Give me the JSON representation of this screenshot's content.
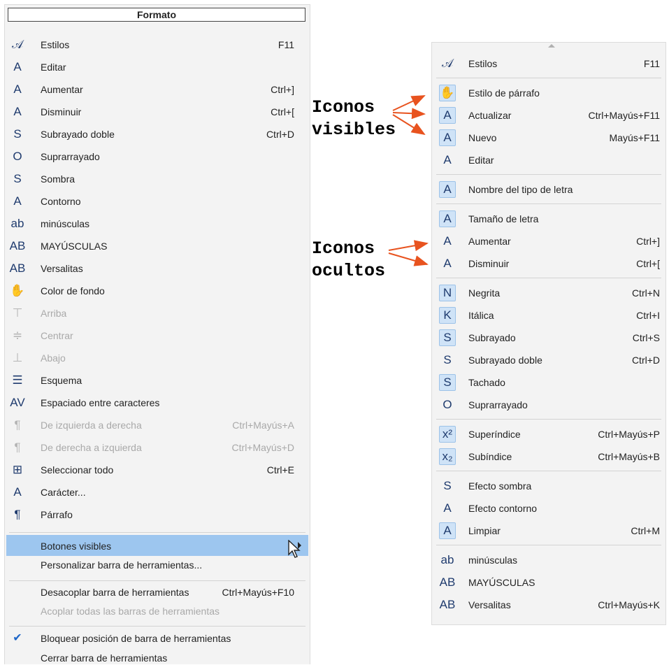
{
  "left_menu": {
    "title": "Formato",
    "items": [
      {
        "name": "estilos",
        "icon": "styles-icon",
        "glyph": "𝒜",
        "label": "Estilos",
        "shortcut": "F11"
      },
      {
        "name": "editar",
        "icon": "edit-style-icon",
        "glyph": "A",
        "label": "Editar",
        "shortcut": ""
      },
      {
        "name": "aumentar",
        "icon": "grow-font-icon",
        "glyph": "A",
        "label": "Aumentar",
        "shortcut": "Ctrl+]"
      },
      {
        "name": "disminuir",
        "icon": "shrink-font-icon",
        "glyph": "A",
        "label": "Disminuir",
        "shortcut": "Ctrl+["
      },
      {
        "name": "subrayado-doble",
        "icon": "double-underline-icon",
        "glyph": "S",
        "label": "Subrayado doble",
        "shortcut": "Ctrl+D"
      },
      {
        "name": "suprarrayado",
        "icon": "overline-icon",
        "glyph": "O",
        "label": "Suprarrayado",
        "shortcut": ""
      },
      {
        "name": "sombra",
        "icon": "shadow-icon",
        "glyph": "S",
        "label": "Sombra",
        "shortcut": ""
      },
      {
        "name": "contorno",
        "icon": "outline-icon",
        "glyph": "A",
        "label": "Contorno",
        "shortcut": ""
      },
      {
        "name": "minusculas",
        "icon": "lowercase-icon",
        "glyph": "ab",
        "label": "minúsculas",
        "shortcut": ""
      },
      {
        "name": "mayusculas",
        "icon": "uppercase-icon",
        "glyph": "AB",
        "label": "MAYÚSCULAS",
        "shortcut": ""
      },
      {
        "name": "versalitas",
        "icon": "smallcaps-icon",
        "glyph": "AB",
        "label": "Versalitas",
        "shortcut": ""
      },
      {
        "name": "color-fondo",
        "icon": "background-color-icon",
        "glyph": "✋",
        "label": "Color de fondo",
        "shortcut": ""
      },
      {
        "name": "arriba",
        "icon": "align-top-icon",
        "glyph": "⊤",
        "label": "Arriba",
        "shortcut": "",
        "disabled": true
      },
      {
        "name": "centrar",
        "icon": "align-middle-icon",
        "glyph": "≑",
        "label": "Centrar",
        "shortcut": "",
        "disabled": true
      },
      {
        "name": "abajo",
        "icon": "align-bottom-icon",
        "glyph": "⊥",
        "label": "Abajo",
        "shortcut": "",
        "disabled": true
      },
      {
        "name": "esquema",
        "icon": "outline-numbering-icon",
        "glyph": "☰",
        "label": "Esquema",
        "shortcut": ""
      },
      {
        "name": "espaciado",
        "icon": "char-spacing-icon",
        "glyph": "AV",
        "label": "Espaciado entre caracteres",
        "shortcut": ""
      },
      {
        "name": "izq-der",
        "icon": "ltr-icon",
        "glyph": "¶",
        "label": "De izquierda a derecha",
        "shortcut": "Ctrl+Mayús+A",
        "disabled": true
      },
      {
        "name": "der-izq",
        "icon": "rtl-icon",
        "glyph": "¶",
        "label": "De derecha a izquierda",
        "shortcut": "Ctrl+Mayús+D",
        "disabled": true
      },
      {
        "name": "seleccionar-todo",
        "icon": "select-all-icon",
        "glyph": "⊞",
        "label": "Seleccionar todo",
        "shortcut": "Ctrl+E"
      },
      {
        "name": "caracter",
        "icon": "character-icon",
        "glyph": "A",
        "label": "Carácter...",
        "shortcut": ""
      },
      {
        "name": "parrafo",
        "icon": "paragraph-icon",
        "glyph": "¶",
        "label": "Párrafo",
        "shortcut": ""
      }
    ],
    "botones_visibles": "Botones visibles",
    "personalizar": "Personalizar barra de herramientas...",
    "desacoplar": "Desacoplar barra de herramientas",
    "desacoplar_shortcut": "Ctrl+Mayús+F10",
    "acoplar": "Acoplar todas las barras de herramientas",
    "bloquear": "Bloquear posición de barra de herramientas",
    "cerrar": "Cerrar barra de herramientas"
  },
  "right_menu": {
    "groups": [
      [
        {
          "name": "estilos",
          "icon": "styles-icon",
          "glyph": "𝒜",
          "label": "Estilos",
          "shortcut": "F11"
        }
      ],
      [
        {
          "name": "estilo-parrafo",
          "icon": "paragraph-style-icon",
          "glyph": "✋",
          "label": "Estilo de párrafo",
          "shortcut": "",
          "boxed": true
        },
        {
          "name": "actualizar",
          "icon": "update-style-icon",
          "glyph": "A",
          "label": "Actualizar",
          "shortcut": "Ctrl+Mayús+F11",
          "boxed": true
        },
        {
          "name": "nuevo",
          "icon": "new-style-icon",
          "glyph": "A",
          "label": "Nuevo",
          "shortcut": "Mayús+F11",
          "boxed": true
        },
        {
          "name": "editar",
          "icon": "edit-style-icon",
          "glyph": "A",
          "label": "Editar",
          "shortcut": ""
        }
      ],
      [
        {
          "name": "nombre-letra",
          "icon": "font-name-icon",
          "glyph": "A",
          "label": "Nombre del tipo de letra",
          "shortcut": "",
          "boxed": true
        }
      ],
      [
        {
          "name": "tamano-letra",
          "icon": "font-size-icon",
          "glyph": "A",
          "label": "Tamaño de letra",
          "shortcut": "",
          "boxed": true
        },
        {
          "name": "aumentar",
          "icon": "grow-font-icon",
          "glyph": "A",
          "label": "Aumentar",
          "shortcut": "Ctrl+]"
        },
        {
          "name": "disminuir",
          "icon": "shrink-font-icon",
          "glyph": "A",
          "label": "Disminuir",
          "shortcut": "Ctrl+["
        }
      ],
      [
        {
          "name": "negrita",
          "icon": "bold-icon",
          "glyph": "N",
          "label": "Negrita",
          "shortcut": "Ctrl+N",
          "boxed": true
        },
        {
          "name": "italica",
          "icon": "italic-icon",
          "glyph": "K",
          "label": "Itálica",
          "shortcut": "Ctrl+I",
          "boxed": true
        },
        {
          "name": "subrayado",
          "icon": "underline-icon",
          "glyph": "S",
          "label": "Subrayado",
          "shortcut": "Ctrl+S",
          "boxed": true
        },
        {
          "name": "subrayado-doble",
          "icon": "double-underline-icon",
          "glyph": "S",
          "label": "Subrayado doble",
          "shortcut": "Ctrl+D"
        },
        {
          "name": "tachado",
          "icon": "strikethrough-icon",
          "glyph": "S",
          "label": "Tachado",
          "shortcut": "",
          "boxed": true
        },
        {
          "name": "suprarrayado",
          "icon": "overline-icon",
          "glyph": "O",
          "label": "Suprarrayado",
          "shortcut": ""
        }
      ],
      [
        {
          "name": "superindice",
          "icon": "superscript-icon",
          "glyph": "x²",
          "label": "Superíndice",
          "shortcut": "Ctrl+Mayús+P",
          "boxed": true
        },
        {
          "name": "subindice",
          "icon": "subscript-icon",
          "glyph": "x₂",
          "label": "Subíndice",
          "shortcut": "Ctrl+Mayús+B",
          "boxed": true
        }
      ],
      [
        {
          "name": "efecto-sombra",
          "icon": "shadow-icon",
          "glyph": "S",
          "label": "Efecto sombra",
          "shortcut": ""
        },
        {
          "name": "efecto-contorno",
          "icon": "outline-icon",
          "glyph": "A",
          "label": "Efecto contorno",
          "shortcut": ""
        },
        {
          "name": "limpiar",
          "icon": "clear-format-icon",
          "glyph": "A",
          "label": "Limpiar",
          "shortcut": "Ctrl+M",
          "boxed": true
        }
      ],
      [
        {
          "name": "minusculas",
          "icon": "lowercase-icon",
          "glyph": "ab",
          "label": "minúsculas",
          "shortcut": ""
        },
        {
          "name": "mayusculas",
          "icon": "uppercase-icon",
          "glyph": "AB",
          "label": "MAYÚSCULAS",
          "shortcut": ""
        },
        {
          "name": "versalitas",
          "icon": "smallcaps-icon",
          "glyph": "AB",
          "label": "Versalitas",
          "shortcut": "Ctrl+Mayús+K"
        }
      ]
    ]
  },
  "annotations": {
    "visible_label": "Iconos\nvisibles",
    "hidden_label": "Iconos\nocultos"
  },
  "colors": {
    "highlight": "#9dc6ef",
    "arrow": "#e8531f",
    "icon_box": "#cfe3f7"
  }
}
